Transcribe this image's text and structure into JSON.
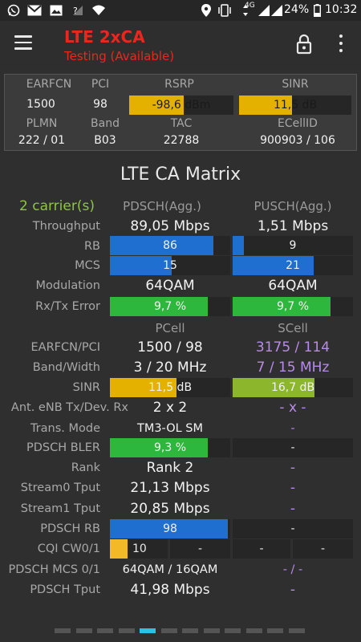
{
  "status_bar": {
    "left_icons": [
      "whatsapp-icon",
      "gmail-icon",
      "gallery-icon",
      "sim-icon",
      "wifi-icon"
    ],
    "battery_percent": "24%",
    "network_type": "4G",
    "time": "10:32"
  },
  "app_bar": {
    "title": "LTE 2xCA",
    "subtitle": "Testing (Available)",
    "accent": "#e8281d"
  },
  "cell_panel": {
    "earfcn_label": "EARFCN",
    "earfcn": "1500",
    "pci_label": "PCI",
    "pci": "98",
    "rsrp_label": "RSRP",
    "rsrp": "-98,6 dBm",
    "rsrp_level": 0.52,
    "sinr_label": "SINR",
    "sinr": "11,5 dB",
    "sinr_level": 0.47,
    "plmn_label": "PLMN",
    "plmn": "222 / 01",
    "band_label": "Band",
    "band": "B03",
    "tac_label": "TAC",
    "tac": "22788",
    "ecellid_label": "ECellID",
    "ecellid": "900903 / 106"
  },
  "matrix": {
    "title": "LTE CA Matrix",
    "carriers": "2 carrier(s)",
    "pdsch_head": "PDSCH(Agg.)",
    "pusch_head": "PUSCH(Agg.)",
    "throughput_label": "Throughput",
    "throughput_pdsch": "89,05 Mbps",
    "throughput_pusch": "1,51 Mbps",
    "rb_label": "RB",
    "rb_pdsch": "86",
    "rb_pdsch_level": 0.86,
    "rb_pusch": "9",
    "rb_pusch_level": 0.09,
    "mcs_label": "MCS",
    "mcs_pdsch": "15",
    "mcs_pdsch_level": 0.51,
    "mcs_pusch": "21",
    "mcs_pusch_level": 0.67,
    "modulation_label": "Modulation",
    "modulation_pdsch": "64QAM",
    "modulation_pusch": "64QAM",
    "error_label": "Rx/Tx Error",
    "error_pdsch": "9,7 %",
    "error_pdsch_level": 0.81,
    "error_pusch": "9,7 %",
    "error_pusch_level": 0.81,
    "pcell_head": "PCell",
    "scell_head": "SCell",
    "earfcn_pci_label": "EARFCN/PCI",
    "earfcn_pci_pcell": "1500 / 98",
    "earfcn_pci_scell": "3175 / 114",
    "band_width_label": "Band/Width",
    "band_width_pcell": "3 / 20 MHz",
    "band_width_scell": "7 / 15 MHz",
    "sinr_label": "SINR",
    "sinr_pcell": "11,5 dB",
    "sinr_pcell_level": 0.55,
    "sinr_scell": "16,7 dB",
    "sinr_scell_level": 0.68,
    "ant_label": "Ant. eNB Tx/Dev. Rx",
    "ant_pcell": "2 x 2",
    "ant_scell": "- x -",
    "trans_mode_label": "Trans. Mode",
    "trans_mode_pcell": "TM3-OL SM",
    "trans_mode_scell": "-",
    "bler_label": "PDSCH BLER",
    "bler_pcell": "9,3 %",
    "bler_pcell_level": 0.81,
    "bler_scell": "-",
    "rank_label": "Rank",
    "rank_pcell": "Rank 2",
    "rank_scell": "-",
    "stream0_label": "Stream0 Tput",
    "stream0_pcell": "21,13 Mbps",
    "stream0_scell": "-",
    "stream1_label": "Stream1 Tput",
    "stream1_pcell": "20,85 Mbps",
    "stream1_scell": "-",
    "pdsch_rb_label": "PDSCH RB",
    "pdsch_rb_pcell": "98",
    "pdsch_rb_pcell_level": 0.98,
    "pdsch_rb_scell": "-",
    "cqi_label": "CQI CW0/1",
    "cqi_pcell_cw0": "10",
    "cqi_pcell_cw1": "-",
    "cqi_scell_cw0": "-",
    "cqi_scell_cw1": "-",
    "pdsch_mcs_label": "PDSCH MCS 0/1",
    "pdsch_mcs_pcell": "64QAM / 16QAM",
    "pdsch_mcs_scell": "- / -",
    "pdsch_tput_label": "PDSCH Tput",
    "pdsch_tput_pcell": "41,98 Mbps",
    "pdsch_tput_scell": "-"
  },
  "colors": {
    "yellow": "#e5b100",
    "blue": "#1e6fd0",
    "green": "#2db83d",
    "olive": "#8cb62b",
    "cqi": "#f4b927",
    "purple": "#b98be8",
    "carriers_green": "#8dc63f",
    "pager_active": "#27c4e8"
  },
  "pager": {
    "pages": 12,
    "active": 5
  }
}
